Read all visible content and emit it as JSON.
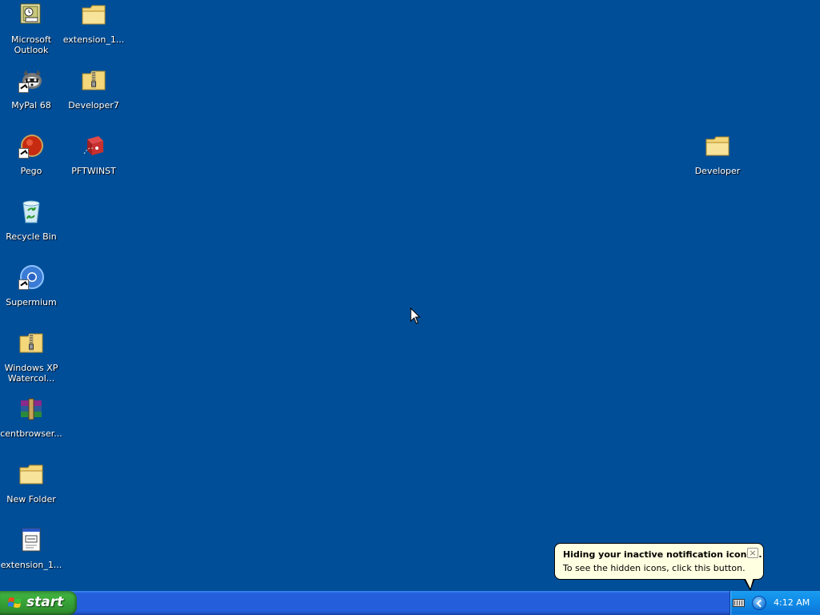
{
  "desktop": {
    "icons": [
      {
        "label": "Microsoft\nOutlook",
        "icon": "outlook-icon",
        "shortcut": false
      },
      {
        "label": "extension_1...",
        "icon": "folder-icon",
        "shortcut": false
      },
      {
        "label": "MyPal 68",
        "icon": "mypal-raccoon-icon",
        "shortcut": true
      },
      {
        "label": "Developer7",
        "icon": "zip-folder-icon",
        "shortcut": false
      },
      {
        "label": "Pego",
        "icon": "pego-icon",
        "shortcut": true
      },
      {
        "label": "PFTWINST",
        "icon": "pftwinst-installer-icon",
        "shortcut": false
      },
      {
        "label": "Recycle Bin",
        "icon": "recycle-bin-icon",
        "shortcut": false
      },
      {
        "label": "Supermium",
        "icon": "supermium-browser-icon",
        "shortcut": true
      },
      {
        "label": "Windows XP\nWatercol...",
        "icon": "zip-folder-icon",
        "shortcut": false
      },
      {
        "label": "centbrowser...",
        "icon": "winrar-archive-icon",
        "shortcut": false
      },
      {
        "label": "New Folder",
        "icon": "folder-icon",
        "shortcut": false
      },
      {
        "label": "extension_1...",
        "icon": "text-document-icon",
        "shortcut": false
      },
      {
        "label": "Developer",
        "icon": "folder-icon",
        "shortcut": false
      }
    ]
  },
  "taskbar": {
    "start_label": "start",
    "tray": {
      "clock": "4:12 AM",
      "keyboard_icon": "keyboard-icon",
      "show_hidden_icon": "chevron-left-icon"
    }
  },
  "balloon": {
    "title": "Hiding your inactive notification icons...",
    "text": "To see the hidden icons, click this button.",
    "close_glyph": "×"
  },
  "colors": {
    "desktop": "#004e98",
    "taskbar": "#245edb",
    "start_button": "#3db03d",
    "tray": "#0f8ae6",
    "balloon": "#ffffe1"
  }
}
